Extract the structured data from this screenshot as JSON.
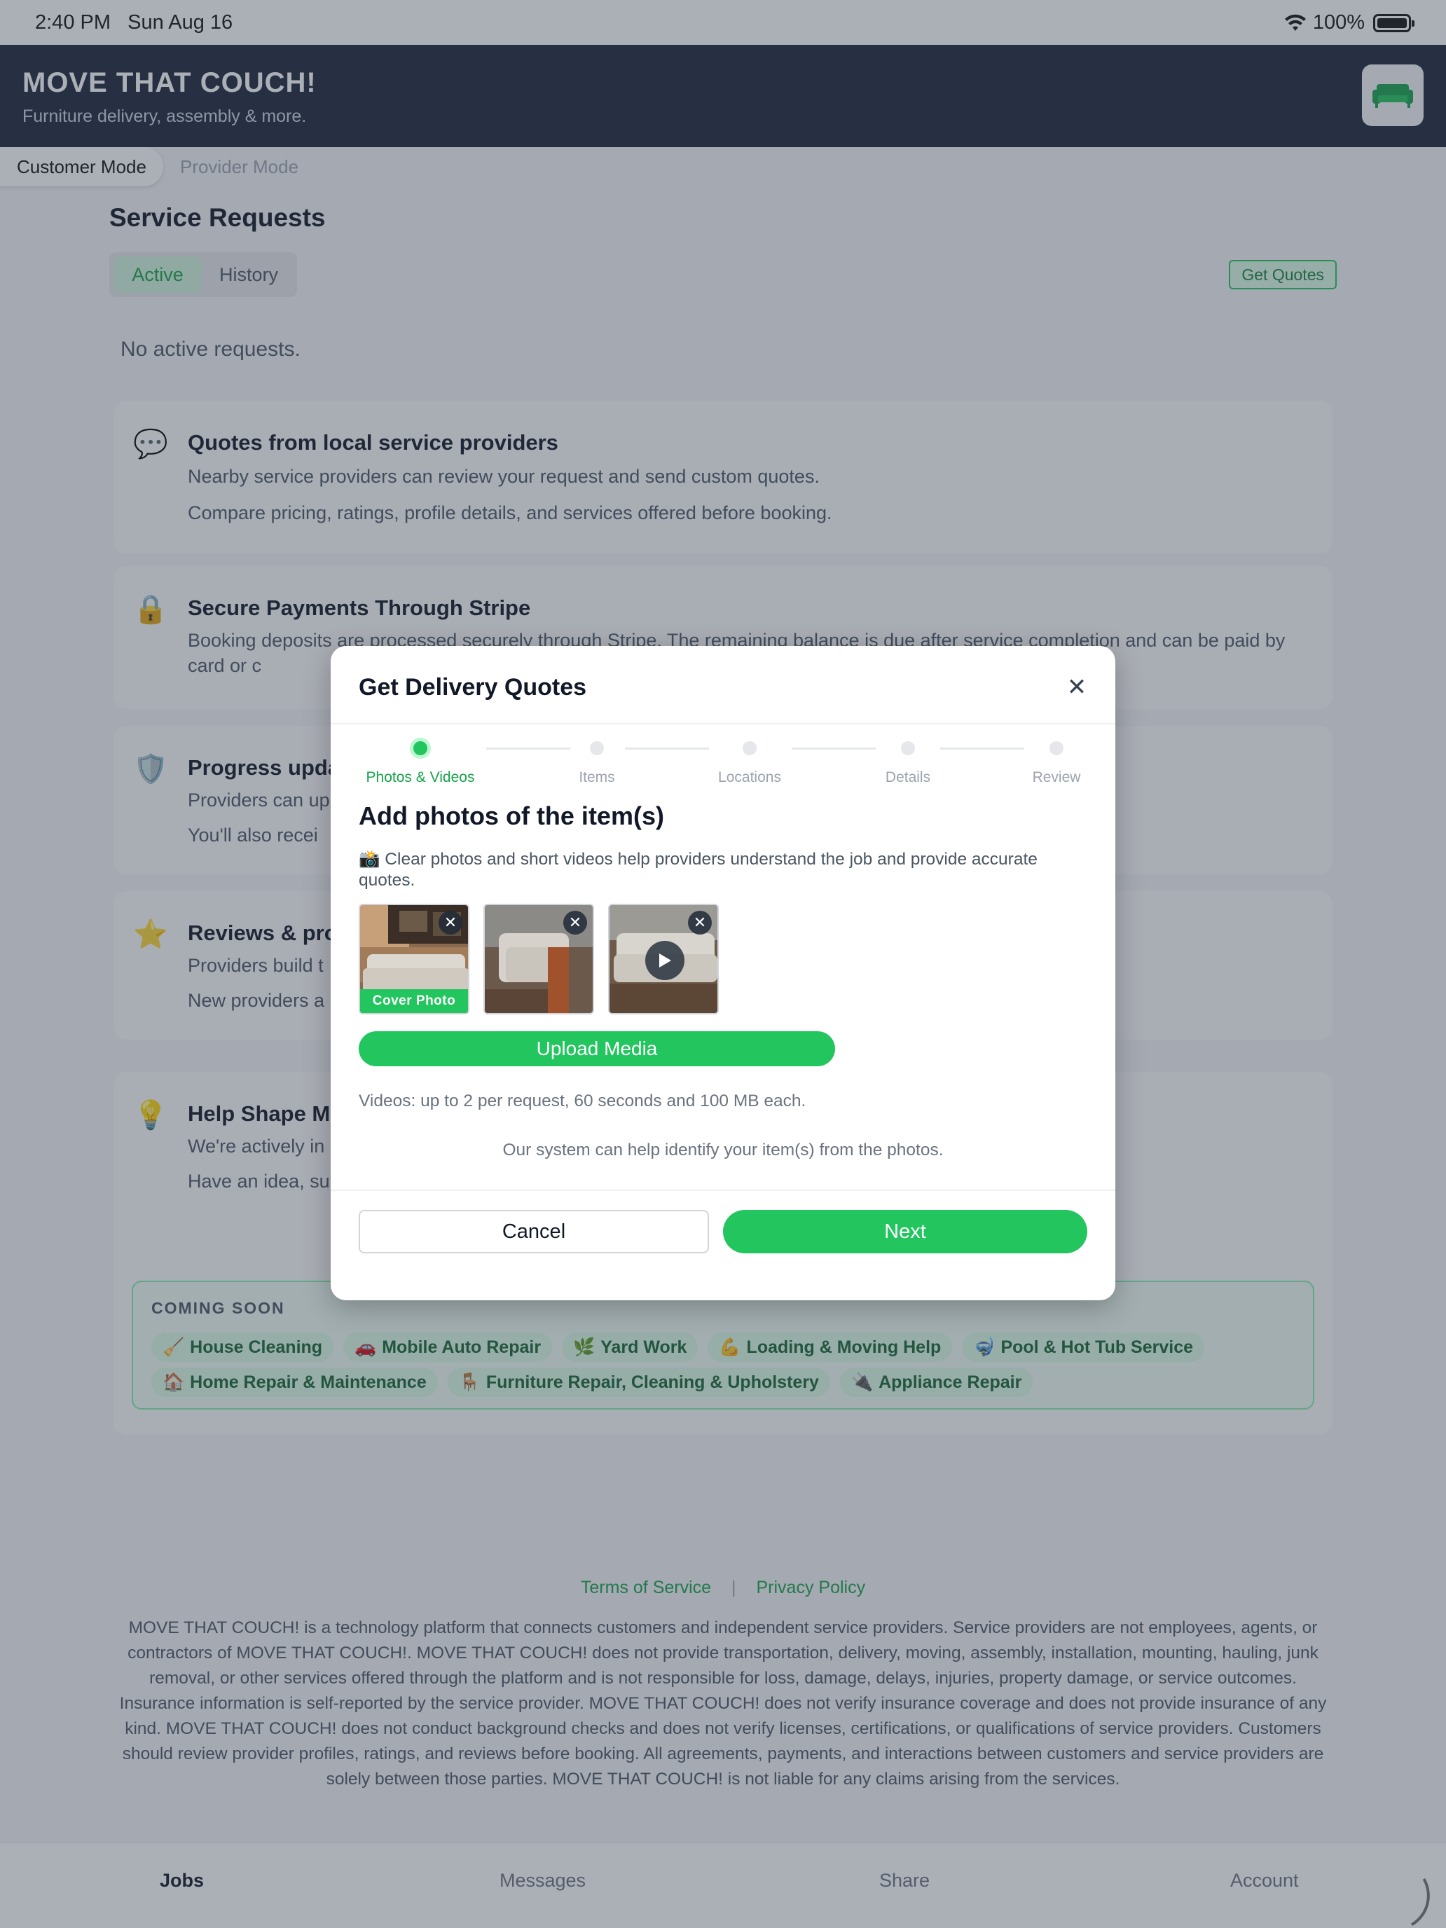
{
  "status_bar": {
    "time": "2:40 PM",
    "date": "Sun Aug 16",
    "battery": "100%"
  },
  "header": {
    "title": "MOVE THAT COUCH!",
    "subtitle": "Furniture delivery, assembly & more.",
    "logo_icon": "couch-icon",
    "accent": "#22c55e",
    "bg": "#1c2539"
  },
  "mode_toggle": {
    "customer": "Customer Mode",
    "provider": "Provider Mode",
    "selected": "Customer Mode"
  },
  "page": {
    "title": "Service Requests",
    "tabs": [
      "Active",
      "History"
    ],
    "active_tab": "Active",
    "get_quotes": "Get Quotes",
    "empty_state": "No active requests."
  },
  "info_cards": [
    {
      "icon": "💬",
      "icon_name": "speech-bubble-icon",
      "title": "Quotes from local service providers",
      "lines": [
        "Nearby service providers can review your request and send custom quotes.",
        "Compare pricing, ratings, profile details, and services offered before booking."
      ]
    },
    {
      "icon": "🔒",
      "icon_name": "lock-icon",
      "title": "Secure Payments Through Stripe",
      "lines": [
        "Booking deposits are processed securely through Stripe. The remaining balance is due after service completion and can be paid by card or c"
      ]
    },
    {
      "icon": "🛡️",
      "icon_name": "shield-icon",
      "title": "Progress upda",
      "lines": [
        "Providers can up",
        "You'll also recei"
      ]
    },
    {
      "icon": "⭐",
      "icon_name": "star-icon",
      "title": "Reviews & pro",
      "lines": [
        "Providers build t",
        "New providers a"
      ]
    },
    {
      "icon": "💡",
      "icon_name": "lightbulb-icon",
      "title": "Help Shape M",
      "lines": [
        "We're actively in",
        "Have an idea, su"
      ]
    }
  ],
  "coming_soon": {
    "label": "COMING SOON",
    "row1": [
      {
        "emoji": "🧹",
        "label": "House Cleaning"
      },
      {
        "emoji": "🚗",
        "label": "Mobile Auto Repair"
      },
      {
        "emoji": "🌿",
        "label": "Yard Work"
      },
      {
        "emoji": "💪",
        "label": "Loading & Moving Help"
      },
      {
        "emoji": "🤿",
        "label": "Pool & Hot Tub Service"
      }
    ],
    "row2": [
      {
        "emoji": "🏠",
        "label": "Home Repair & Maintenance"
      },
      {
        "emoji": "🪑",
        "label": "Furniture Repair, Cleaning & Upholstery"
      },
      {
        "emoji": "🔌",
        "label": "Appliance Repair"
      }
    ]
  },
  "footer": {
    "terms": "Terms of Service",
    "separator": "|",
    "privacy": "Privacy Policy",
    "disclaimer": "MOVE THAT COUCH! is a technology platform that connects customers and independent service providers. Service providers are not employees, agents, or contractors of MOVE THAT COUCH!. MOVE THAT COUCH! does not provide transportation, delivery, moving, assembly, installation, mounting, hauling, junk removal, or other services offered through the platform and is not responsible for loss, damage, delays, injuries, property damage, or service outcomes. Insurance information is self-reported by the service provider. MOVE THAT COUCH! does not verify insurance coverage and does not provide insurance of any kind. MOVE THAT COUCH! does not conduct background checks and does not verify licenses, certifications, or qualifications of service providers. Customers should review provider profiles, ratings, and reviews before booking. All agreements, payments, and interactions between customers and service providers are solely between those parties. MOVE THAT COUCH! is not liable for any claims arising from the services."
  },
  "bottom_nav": {
    "items": [
      "Jobs",
      "Messages",
      "Share",
      "Account"
    ],
    "active": "Jobs"
  },
  "modal": {
    "title": "Get Delivery Quotes",
    "close_icon": "close-icon",
    "steps": [
      "Photos & Videos",
      "Items",
      "Locations",
      "Details",
      "Review"
    ],
    "current_step": "Photos & Videos",
    "heading": "Add photos of the item(s)",
    "help_text": "📸 Clear photos and short videos help providers understand the job and provide accurate quotes.",
    "media": [
      {
        "kind": "photo",
        "cover": true,
        "cover_label": "Cover Photo"
      },
      {
        "kind": "photo",
        "cover": false
      },
      {
        "kind": "video",
        "cover": false
      }
    ],
    "upload_label": "Upload Media",
    "video_note": "Videos: up to 2 per request, 60 seconds and 100 MB each.",
    "system_note": "Our system can help identify your item(s) from the photos.",
    "cancel_label": "Cancel",
    "next_label": "Next"
  }
}
